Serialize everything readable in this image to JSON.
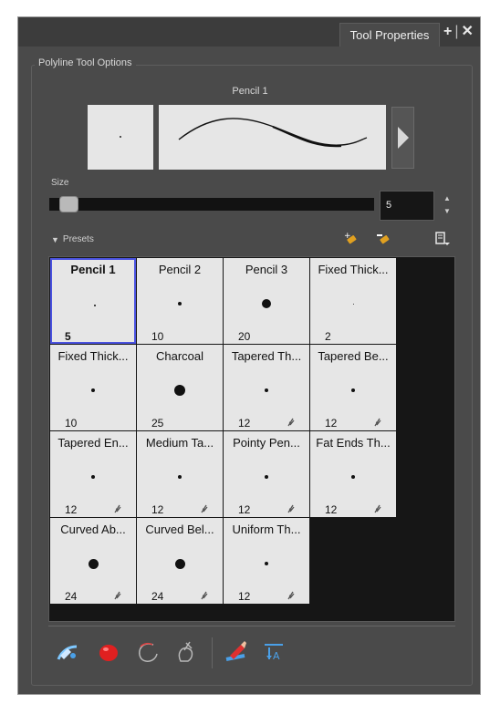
{
  "panel": {
    "tab_title": "Tool Properties",
    "group_title": "Polyline Tool Options",
    "current_preset": "Pencil 1"
  },
  "size": {
    "label": "Size",
    "value": "5",
    "slider_fraction": 0.02
  },
  "presets": {
    "header_label": "Presets",
    "items": [
      {
        "name": "Pencil 1",
        "size": "5",
        "selected": true,
        "pen_icon": false
      },
      {
        "name": "Pencil 2",
        "size": "10",
        "selected": false,
        "pen_icon": false
      },
      {
        "name": "Pencil 3",
        "size": "20",
        "selected": false,
        "pen_icon": false
      },
      {
        "name": "Fixed Thick...",
        "size": "2",
        "selected": false,
        "pen_icon": false
      },
      {
        "name": "Fixed Thick...",
        "size": "10",
        "selected": false,
        "pen_icon": false
      },
      {
        "name": "Charcoal",
        "size": "25",
        "selected": false,
        "pen_icon": false
      },
      {
        "name": "Tapered Th...",
        "size": "12",
        "selected": false,
        "pen_icon": true
      },
      {
        "name": "Tapered Be...",
        "size": "12",
        "selected": false,
        "pen_icon": true
      },
      {
        "name": "Tapered En...",
        "size": "12",
        "selected": false,
        "pen_icon": true
      },
      {
        "name": "Medium Ta...",
        "size": "12",
        "selected": false,
        "pen_icon": true
      },
      {
        "name": "Pointy Pen...",
        "size": "12",
        "selected": false,
        "pen_icon": true
      },
      {
        "name": "Fat Ends Th...",
        "size": "12",
        "selected": false,
        "pen_icon": true
      },
      {
        "name": "Curved Ab...",
        "size": "24",
        "selected": false,
        "pen_icon": true
      },
      {
        "name": "Curved Bel...",
        "size": "24",
        "selected": false,
        "pen_icon": true
      },
      {
        "name": "Uniform Th...",
        "size": "12",
        "selected": false,
        "pen_icon": true
      }
    ]
  },
  "icons": {
    "tab_add": "plus-icon",
    "tab_close": "close-icon",
    "new_preset": "new-brush-preset-icon",
    "rename_preset": "rename-brush-preset-icon",
    "preset_menu": "preset-menu-icon",
    "tools": [
      "auto-flatten-icon",
      "create-colour-art-icon",
      "auto-close-gap-icon",
      "auto-fill-icon",
      "paint-behind-icon",
      "create-stroke-icon"
    ]
  },
  "colors": {
    "selection_border": "#4a52e0",
    "panel_bg": "#4a4a4a",
    "cell_bg": "#e6e6e6"
  }
}
